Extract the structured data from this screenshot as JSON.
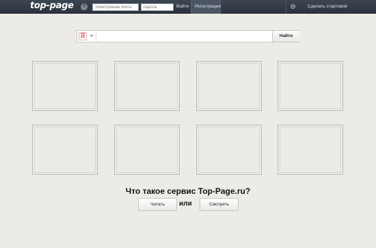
{
  "header": {
    "logo": "top-page",
    "help_icon": "question-icon",
    "email_placeholder": "Электронная почта",
    "password_placeholder": "пароль",
    "login_label": "Войти",
    "register_label": "Регистрация",
    "settings_icon": "gear-icon",
    "make_start_label": "Сделать стартовой"
  },
  "search": {
    "engine_badge": "Я",
    "query": "",
    "button_label": "Найти"
  },
  "tiles": [
    {
      "label": ""
    },
    {
      "label": ""
    },
    {
      "label": ""
    },
    {
      "label": ""
    },
    {
      "label": ""
    },
    {
      "label": ""
    },
    {
      "label": ""
    },
    {
      "label": ""
    }
  ],
  "promo": {
    "question": "Что такое сервис Top-Page.ru?",
    "read_label": "Читать",
    "or_label": "или",
    "watch_label": "Смотреть"
  },
  "colors": {
    "topbar": "#2c333d",
    "background": "#ecebe6",
    "yandex_red": "#d52a2a"
  }
}
